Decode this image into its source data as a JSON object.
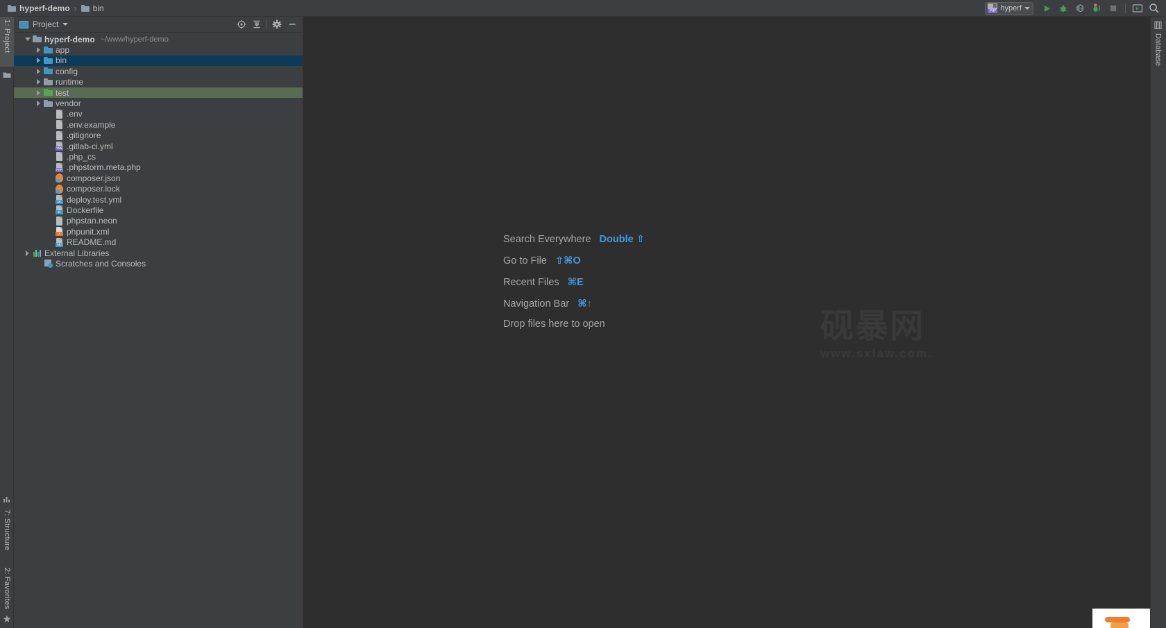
{
  "window": {
    "background": "#3c3f41",
    "editor_background": "#2e2e2e",
    "accent_blue": "#3f9ae0",
    "selection_blue": "#0d3a58",
    "test_green": "#5a6a54"
  },
  "breadcrumb": {
    "items": [
      {
        "label": "hyperf-demo",
        "icon": "folder-icon"
      },
      {
        "label": "bin",
        "icon": "folder-icon"
      }
    ],
    "separator": "›"
  },
  "toolbar": {
    "run_config": {
      "name": "hyperf",
      "icon": "php-run-config-icon",
      "caret": "chevron-down-icon"
    },
    "buttons": [
      {
        "name": "run-button",
        "icon": "run-triangle-icon",
        "label": "Run"
      },
      {
        "name": "debug-button",
        "icon": "debug-bug-icon",
        "label": "Debug"
      },
      {
        "name": "run-with-coverage-button",
        "icon": "coverage-icon",
        "label": "Run with Coverage"
      },
      {
        "name": "profile-button",
        "icon": "profile-icon",
        "label": "Profile"
      },
      {
        "name": "stop-button",
        "icon": "stop-square-icon",
        "label": "Stop"
      },
      {
        "name": "terminal-button",
        "icon": "terminal-icon",
        "label": "Terminal"
      },
      {
        "name": "search-button",
        "icon": "search-icon",
        "label": "Search Everywhere"
      }
    ]
  },
  "left_stripe": {
    "tabs": [
      {
        "label": "1: Project",
        "icon": "project-folder-icon",
        "active": true
      },
      {
        "label": "7: Structure",
        "icon": "structure-icon",
        "active": false
      },
      {
        "label": "2: Favorites",
        "icon": "star-icon",
        "active": false
      }
    ]
  },
  "right_stripe": {
    "tabs": [
      {
        "label": "Database",
        "icon": "database-icon",
        "active": false
      }
    ]
  },
  "project_panel": {
    "title": "Project",
    "caret": "chevron-down-icon",
    "actions": [
      {
        "name": "scroll-from-source-button",
        "icon": "target-icon"
      },
      {
        "name": "collapse-all-button",
        "icon": "collapse-all-icon"
      },
      {
        "name": "settings-button",
        "icon": "gear-icon"
      },
      {
        "name": "hide-button",
        "icon": "minimize-icon"
      }
    ],
    "tree": [
      {
        "label": "hyperf-demo",
        "path": "~/www/hyperf-demo",
        "indent": 0,
        "twisty": "down",
        "icon": "folder",
        "iconColor": "grey",
        "bold": true,
        "state": "none"
      },
      {
        "label": "app",
        "indent": 1,
        "twisty": "right",
        "icon": "folder",
        "iconColor": "blue",
        "state": "none"
      },
      {
        "label": "bin",
        "indent": 1,
        "twisty": "right",
        "icon": "folder",
        "iconColor": "blue",
        "state": "selected"
      },
      {
        "label": "config",
        "indent": 1,
        "twisty": "right",
        "icon": "folder",
        "iconColor": "blue",
        "state": "none"
      },
      {
        "label": "runtime",
        "indent": 1,
        "twisty": "right",
        "icon": "folder",
        "iconColor": "grey",
        "state": "none"
      },
      {
        "label": "test",
        "indent": 1,
        "twisty": "right",
        "icon": "folder",
        "iconColor": "green",
        "state": "test"
      },
      {
        "label": "vendor",
        "indent": 1,
        "twisty": "right",
        "icon": "folder",
        "iconColor": "grey",
        "state": "none"
      },
      {
        "label": ".env",
        "indent": 2,
        "twisty": "none",
        "icon": "file",
        "tag": "",
        "state": "none"
      },
      {
        "label": ".env.example",
        "indent": 2,
        "twisty": "none",
        "icon": "file",
        "tag": "",
        "state": "none"
      },
      {
        "label": ".gitignore",
        "indent": 2,
        "twisty": "none",
        "icon": "file",
        "tag": "",
        "state": "none"
      },
      {
        "label": ".gitlab-ci.yml",
        "indent": 2,
        "twisty": "none",
        "icon": "file",
        "tag": "YML",
        "tagColor": "#7b68c8",
        "state": "none"
      },
      {
        "label": ".php_cs",
        "indent": 2,
        "twisty": "none",
        "icon": "file",
        "tag": "",
        "state": "none"
      },
      {
        "label": ".phpstorm.meta.php",
        "indent": 2,
        "twisty": "none",
        "icon": "file",
        "tag": "PHP",
        "tagColor": "#7b68c8",
        "state": "none"
      },
      {
        "label": "composer.json",
        "indent": 2,
        "twisty": "none",
        "icon": "composer",
        "state": "none"
      },
      {
        "label": "composer.lock",
        "indent": 2,
        "twisty": "none",
        "icon": "composer",
        "state": "none"
      },
      {
        "label": "deploy.test.yml",
        "indent": 2,
        "twisty": "none",
        "icon": "file",
        "tag": "DC",
        "tagColor": "#3d97c7",
        "state": "none"
      },
      {
        "label": "Dockerfile",
        "indent": 2,
        "twisty": "none",
        "icon": "file",
        "tag": "D",
        "tagColor": "#3d97c7",
        "state": "none"
      },
      {
        "label": "phpstan.neon",
        "indent": 2,
        "twisty": "none",
        "icon": "file",
        "tag": "",
        "state": "none"
      },
      {
        "label": "phpunit.xml",
        "indent": 2,
        "twisty": "none",
        "icon": "file-orange",
        "tag": "X",
        "tagColor": "#e07a32",
        "state": "none"
      },
      {
        "label": "README.md",
        "indent": 2,
        "twisty": "none",
        "icon": "file",
        "tag": "MD",
        "tagColor": "#3d97c7",
        "state": "none"
      },
      {
        "label": "External Libraries",
        "indent": 0,
        "twisty": "right",
        "icon": "libs",
        "state": "none"
      },
      {
        "label": "Scratches and Consoles",
        "indent": 1,
        "twisty": "none",
        "icon": "scratch",
        "state": "none"
      }
    ]
  },
  "editor": {
    "hints": [
      {
        "name": "Search Everywhere",
        "key": "Double ⇧"
      },
      {
        "name": "Go to File",
        "key": "⇧⌘O"
      },
      {
        "name": "Recent Files",
        "key": "⌘E"
      },
      {
        "name": "Navigation Bar",
        "key": "⌘↑"
      }
    ],
    "drop_hint": "Drop files here to open",
    "watermark": {
      "cn": "砚暴网",
      "url": "www.sxiaw.com."
    }
  },
  "annotation": {
    "arrow": {
      "color": "#ff2a1f",
      "points_to": "run-button"
    }
  }
}
